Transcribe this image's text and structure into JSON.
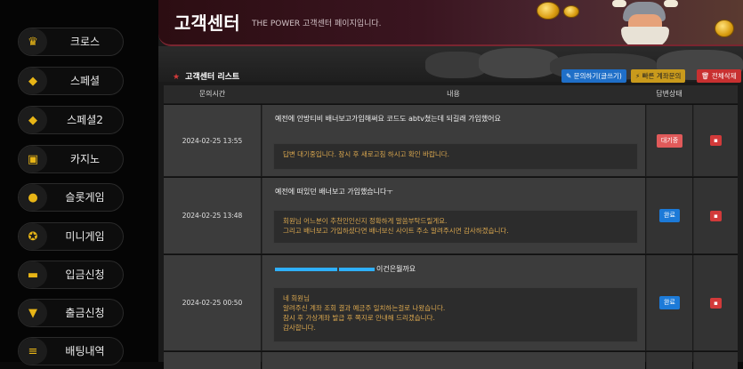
{
  "sidebar": {
    "items": [
      {
        "label": "크로스",
        "icon": "crown-icon"
      },
      {
        "label": "스페셜",
        "icon": "diamond-icon"
      },
      {
        "label": "스페셜2",
        "icon": "diamond-icon"
      },
      {
        "label": "카지노",
        "icon": "cards-icon"
      },
      {
        "label": "슬롯게임",
        "icon": "cherry-icon"
      },
      {
        "label": "미니게임",
        "icon": "medal-icon"
      },
      {
        "label": "입금신청",
        "icon": "wallet-icon"
      },
      {
        "label": "출금신청",
        "icon": "withdraw-icon"
      },
      {
        "label": "배팅내역",
        "icon": "coins-icon"
      }
    ]
  },
  "header": {
    "title": "고객센터",
    "subtitle": "THE POWER 고객센터 페이지입니다."
  },
  "list": {
    "title": "고객센터 리스트",
    "write_button": "문의하기(글쓰기)",
    "quick_button": "빠른 계좌문의",
    "delete_all_button": "전체삭제"
  },
  "table": {
    "headers": {
      "time": "문의시간",
      "content": "내용",
      "status": "답변상태"
    },
    "rows": [
      {
        "time": "2024-02-25 13:55",
        "question": "예전에 안방티비 배너보고가입해써요 코드도 abtv쳤는데 되길래 가입했어요",
        "answer": [
          "답변 대기중입니다. 잠시 후 새로고침 하시고 확인 바랍니다."
        ],
        "status": "대기중",
        "status_type": "wait"
      },
      {
        "time": "2024-02-25 13:48",
        "question": "예전에 떠있던 배너보고 가입했습니다ㅜ",
        "answer": [
          "회원님 어느분이 추천인인신지 정확하게 말씀부탁드릴게요.",
          "그리고 배너보고 가입하셨다면 배너보신 사이트 주소 알려주시면 감사하겠습니다."
        ],
        "status": "완료",
        "status_type": "done"
      },
      {
        "time": "2024-02-25 00:50",
        "question": "이건은뭘까요",
        "answer": [
          "네 회원님",
          "알려주신 계좌 조회 결과 예금주 일치하는걸로 나왔습니다.",
          "잠시 후 가상계좌 발급 후 쪽지로 안내해 드리겠습니다.",
          "감사합니다."
        ],
        "status": "완료",
        "status_type": "done"
      }
    ]
  },
  "colors": {
    "accent": "#e8b516",
    "wait": "#e05a5a",
    "done": "#1c7ad8",
    "answer_text": "#d9a64e"
  }
}
